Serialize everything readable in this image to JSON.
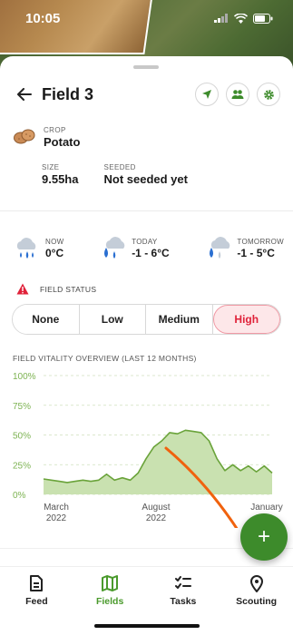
{
  "status_bar": {
    "time": "10:05"
  },
  "header": {
    "title": "Field 3"
  },
  "crop": {
    "label": "CROP",
    "value": "Potato"
  },
  "size": {
    "label": "SIZE",
    "value": "9.55ha"
  },
  "seeded": {
    "label": "SEEDED",
    "value": "Not seeded yet"
  },
  "weather": [
    {
      "label": "NOW",
      "value": "0°C",
      "icon": "rain-cloud-icon"
    },
    {
      "label": "TODAY",
      "value": "-1 - 6°C",
      "icon": "rain-cloud-icon"
    },
    {
      "label": "TOMORROW",
      "value": "-1 - 5°C",
      "icon": "rain-cloud-icon"
    }
  ],
  "field_status": {
    "label": "FIELD STATUS",
    "options": [
      "None",
      "Low",
      "Medium",
      "High"
    ],
    "selected": "High"
  },
  "vitality": {
    "title": "FIELD VITALITY OVERVIEW (LAST 12 MONTHS)"
  },
  "chart_data": {
    "type": "area",
    "yticks": [
      "100%",
      "75%",
      "50%",
      "25%",
      "0%"
    ],
    "ylim": [
      0,
      100
    ],
    "xticks": [
      {
        "line1": "March",
        "line2": "2022"
      },
      {
        "line1": "August",
        "line2": "2022"
      },
      {
        "line1": "January",
        "line2": ""
      }
    ],
    "values": [
      13,
      12,
      11,
      10,
      11,
      12,
      11,
      12,
      17,
      12,
      14,
      12,
      18,
      30,
      40,
      45,
      52,
      51,
      54,
      53,
      52,
      45,
      30,
      20,
      25,
      20,
      24,
      19,
      24,
      18
    ],
    "color": "#6aa33a",
    "fill": "#c9e1b0"
  },
  "fab": {
    "label": "+"
  },
  "tabs": [
    {
      "label": "Feed",
      "icon": "document-icon"
    },
    {
      "label": "Fields",
      "icon": "map-icon",
      "active": true
    },
    {
      "label": "Tasks",
      "icon": "checklist-icon"
    },
    {
      "label": "Scouting",
      "icon": "location-pin-icon"
    }
  ]
}
